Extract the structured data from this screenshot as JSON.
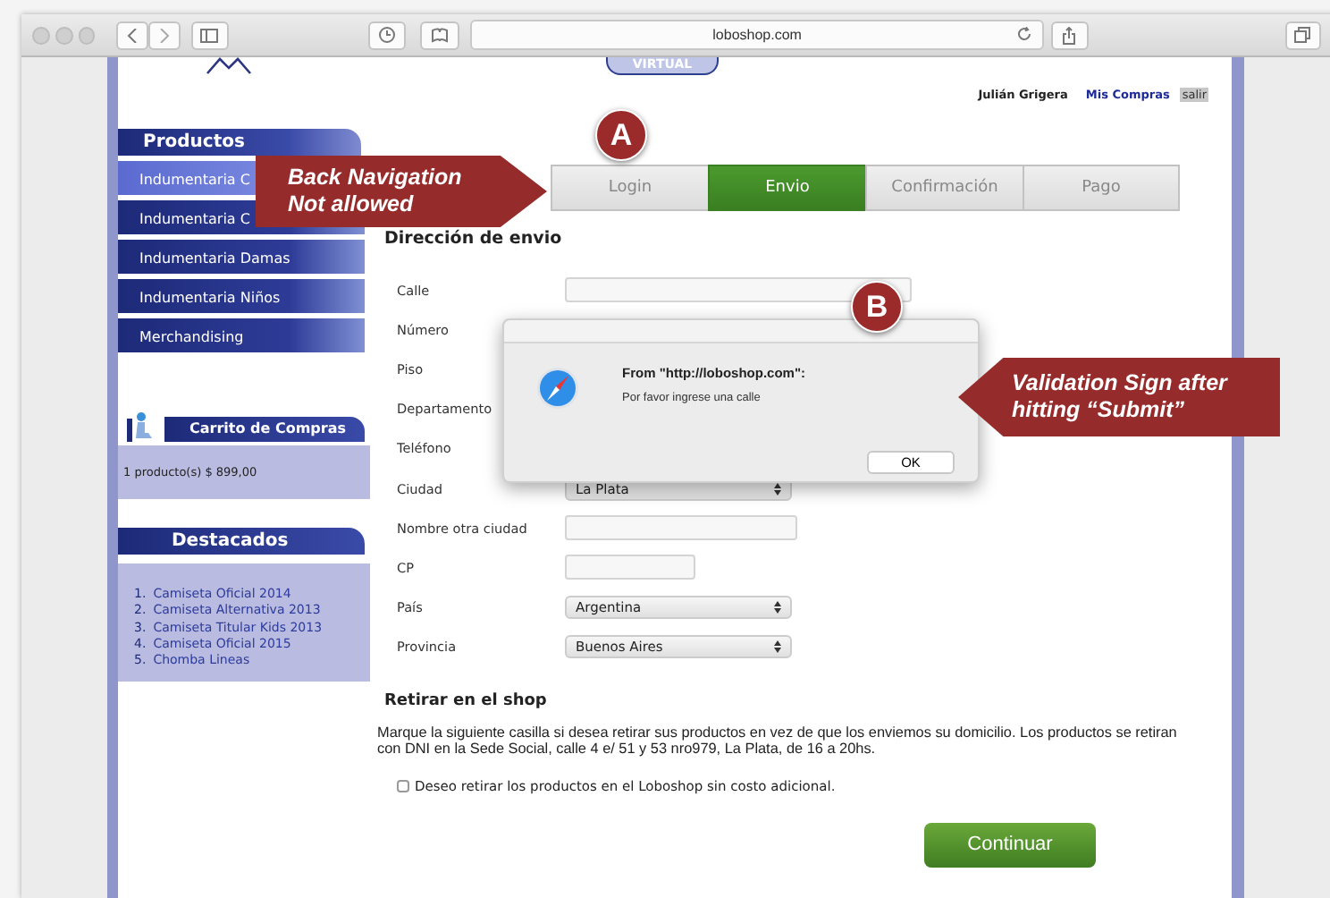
{
  "browser": {
    "url": "loboshop.com"
  },
  "header": {
    "badge": "VIRTUAL",
    "user": "Julián Grigera",
    "links": [
      {
        "label": "Mis Compras",
        "selected": false
      },
      {
        "label": "salir",
        "selected": true
      }
    ]
  },
  "sidebar": {
    "products_title": "Productos",
    "items": [
      {
        "label": "Indumentaria C",
        "selected": true
      },
      {
        "label": "Indumentaria C",
        "selected": false
      },
      {
        "label": "Indumentaria Damas",
        "selected": false
      },
      {
        "label": "Indumentaria Niños",
        "selected": false
      },
      {
        "label": "Merchandising",
        "selected": false
      }
    ],
    "cart_title": "Carrito de Compras",
    "cart_summary": "1 producto(s) $ 899,00",
    "featured_title": "Destacados",
    "featured": [
      {
        "number": "1.",
        "label": "Camiseta Oficial 2014"
      },
      {
        "number": "2.",
        "label": "Camiseta Alternativa 2013"
      },
      {
        "number": "3.",
        "label": "Camiseta Titular Kids 2013"
      },
      {
        "number": "4.",
        "label": "Camiseta Oficial 2015"
      },
      {
        "number": "5.",
        "label": "Chomba Lineas"
      }
    ]
  },
  "steps": [
    {
      "label": "Login",
      "selected": false
    },
    {
      "label": "Envio",
      "selected": true
    },
    {
      "label": "Confirmación",
      "selected": false
    },
    {
      "label": "Pago",
      "selected": false
    }
  ],
  "form": {
    "title": "Dirección de envio",
    "fields": [
      {
        "label": "Calle",
        "kind": "input"
      },
      {
        "label": "Número",
        "kind": "label"
      },
      {
        "label": "Piso",
        "kind": "label"
      },
      {
        "label": "Departamento",
        "kind": "label"
      },
      {
        "label": "Teléfono",
        "kind": "label"
      },
      {
        "label": "Ciudad",
        "kind": "select",
        "value": "La Plata"
      },
      {
        "label": "Nombre otra ciudad",
        "kind": "input"
      },
      {
        "label": "CP",
        "kind": "input"
      },
      {
        "label": "País",
        "kind": "select",
        "value": "Argentina"
      },
      {
        "label": "Provincia",
        "kind": "select",
        "value": "Buenos Aires"
      }
    ]
  },
  "pickup": {
    "title": "Retirar en el shop",
    "text": "Marque la siguiente casilla si desea retirar sus productos en vez de que los enviemos su domicilio. Los productos se retiran con DNI en la Sede Social, calle 4 e/ 51 y 53 nro979, La Plata, de 16 a 20hs.",
    "checkbox": {
      "label": "Deseo retirar los productos en el Loboshop sin costo adicional.",
      "checked": false
    }
  },
  "continue_button": "Continuar",
  "dialog": {
    "title": "From \"http://loboshop.com\":",
    "message": "Por favor ingrese una calle",
    "button": "OK"
  },
  "badges": [
    {
      "text": "A"
    },
    {
      "text": "B"
    }
  ],
  "callouts": [
    {
      "lines": [
        "Back Navigation",
        "Not allowed"
      ]
    },
    {
      "lines": [
        "Validation Sign after",
        "hitting “Submit”"
      ]
    }
  ]
}
